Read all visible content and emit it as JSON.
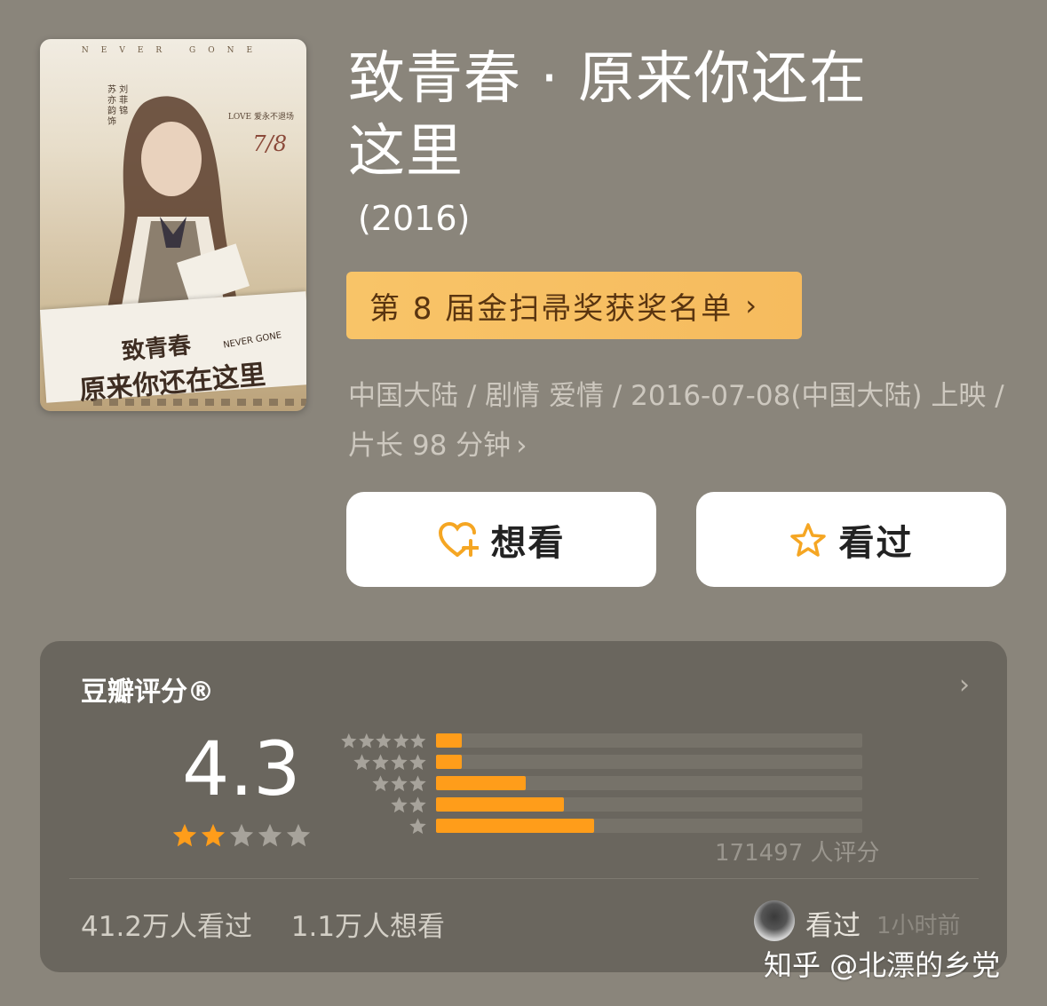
{
  "poster": {
    "top_text": "NEVER GONE",
    "date": "7/8",
    "love": "LOVE 爱永不退场",
    "cast": "苏 刘 亦 菲 韵 锦 饰",
    "title_line1": "致青春",
    "title_line2": "原来你还在这里",
    "subtitle": "NEVER GONE"
  },
  "movie": {
    "title": "致青春 · 原来你还在这里",
    "year": "(2016)",
    "award_label": "第 8 届金扫帚奖获奖名单",
    "meta": "中国大陆 / 剧情 爱情 / 2016-07-08(中国大陆) 上映 / 片长 98 分钟"
  },
  "buttons": {
    "want": "想看",
    "seen": "看过"
  },
  "rating": {
    "title": "豆瓣评分®",
    "score": "4.3",
    "stars_filled": 2,
    "stars_total": 5,
    "distribution": [
      {
        "stars": 5,
        "fraction": 0.06
      },
      {
        "stars": 4,
        "fraction": 0.06
      },
      {
        "stars": 3,
        "fraction": 0.21
      },
      {
        "stars": 2,
        "fraction": 0.3
      },
      {
        "stars": 1,
        "fraction": 0.37
      }
    ],
    "count_text": "171497 人评分",
    "seen_count": "41.2万人看过",
    "want_count": "1.1万人想看",
    "recent_label": "看过",
    "recent_time": "1小时前"
  },
  "colors": {
    "accent": "#ff9d1a",
    "award_bg": "#f8c468",
    "page_bg": "#8a857b",
    "card_bg": "#6a665e"
  },
  "watermark": "知乎 @北漂的乡党"
}
